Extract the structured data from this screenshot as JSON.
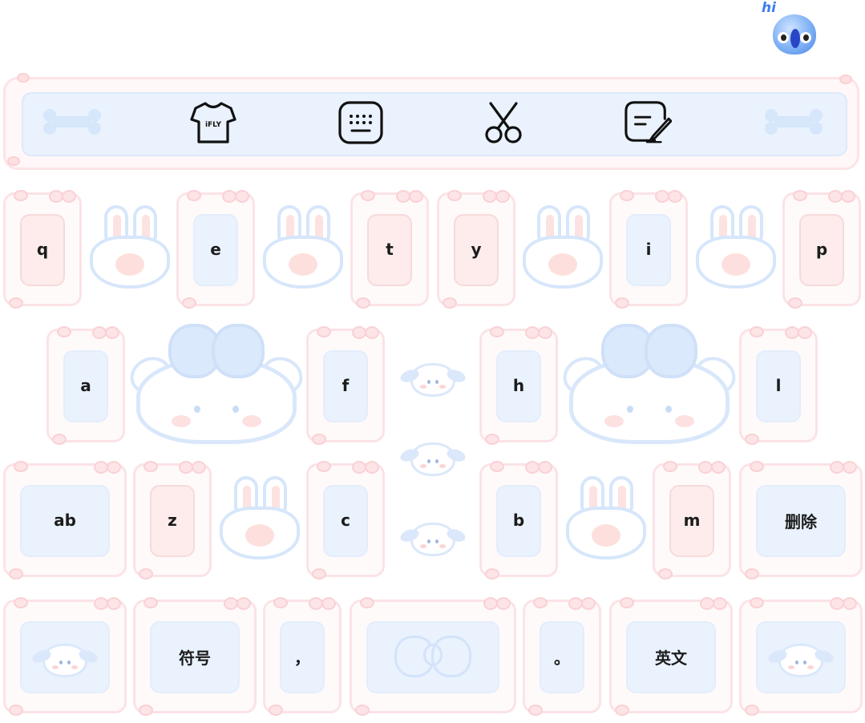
{
  "mascot": {
    "bubble_text": "hi",
    "icon": "ifly-bird-mascot-icon"
  },
  "toolbar": {
    "items": [
      {
        "name": "theme-skin",
        "icon": "tshirt-icon",
        "icon_text": "iFLY"
      },
      {
        "name": "keyboard-layout",
        "icon": "keyboard-icon"
      },
      {
        "name": "clipboard",
        "icon": "scissors-icon"
      },
      {
        "name": "handwriting",
        "icon": "handwriting-note-icon"
      }
    ],
    "decor": [
      "bone-icon",
      "bone-icon"
    ]
  },
  "keyboard": {
    "row1": [
      "q",
      "e",
      "t",
      "y",
      "i",
      "p"
    ],
    "row2": [
      "a",
      "f",
      "h",
      "l"
    ],
    "row3": {
      "mode": "ab",
      "letters": [
        "z",
        "c",
        "b",
        "m"
      ],
      "delete": "删除"
    },
    "row4": {
      "symbols": "符号",
      "comma": "，",
      "space": "",
      "period": "。",
      "lang": "英文"
    }
  },
  "colors": {
    "key_frame": "#fbe3e6",
    "key_inner_blue": "#eaf2fe",
    "key_inner_pink": "#fdeceb",
    "decor_blue": "#d6e6fb",
    "label": "#1c1c1c",
    "mascot_blue": "#4d86e6"
  }
}
